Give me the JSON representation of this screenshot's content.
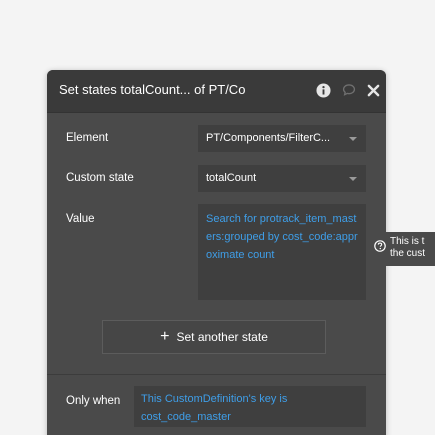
{
  "dialog": {
    "title": "Set states totalCount... of PT/Co",
    "icons": [
      "info-icon",
      "comment-icon",
      "close-icon"
    ],
    "colors": {
      "panel": "#4a4a4a",
      "header": "#3a3a3a",
      "field": "#3f3f3f",
      "expression": "#3f9ee8",
      "text": "#ffffff"
    }
  },
  "element": {
    "label": "Element",
    "value": "PT/Components/FilterC..."
  },
  "custom_state": {
    "label": "Custom state",
    "value": "totalCount"
  },
  "value": {
    "label": "Value",
    "expression": "Search for protrack_item_masters:grouped by cost_code:approximate count"
  },
  "add_state_button": {
    "label": "Set another state",
    "icon": "plus-icon"
  },
  "only_when": {
    "label": "Only when",
    "expression": "This CustomDefinition's key is cost_code_master"
  },
  "tooltip": {
    "line1": "This is t",
    "line2": "the cust",
    "icon": "help-circle-icon"
  }
}
